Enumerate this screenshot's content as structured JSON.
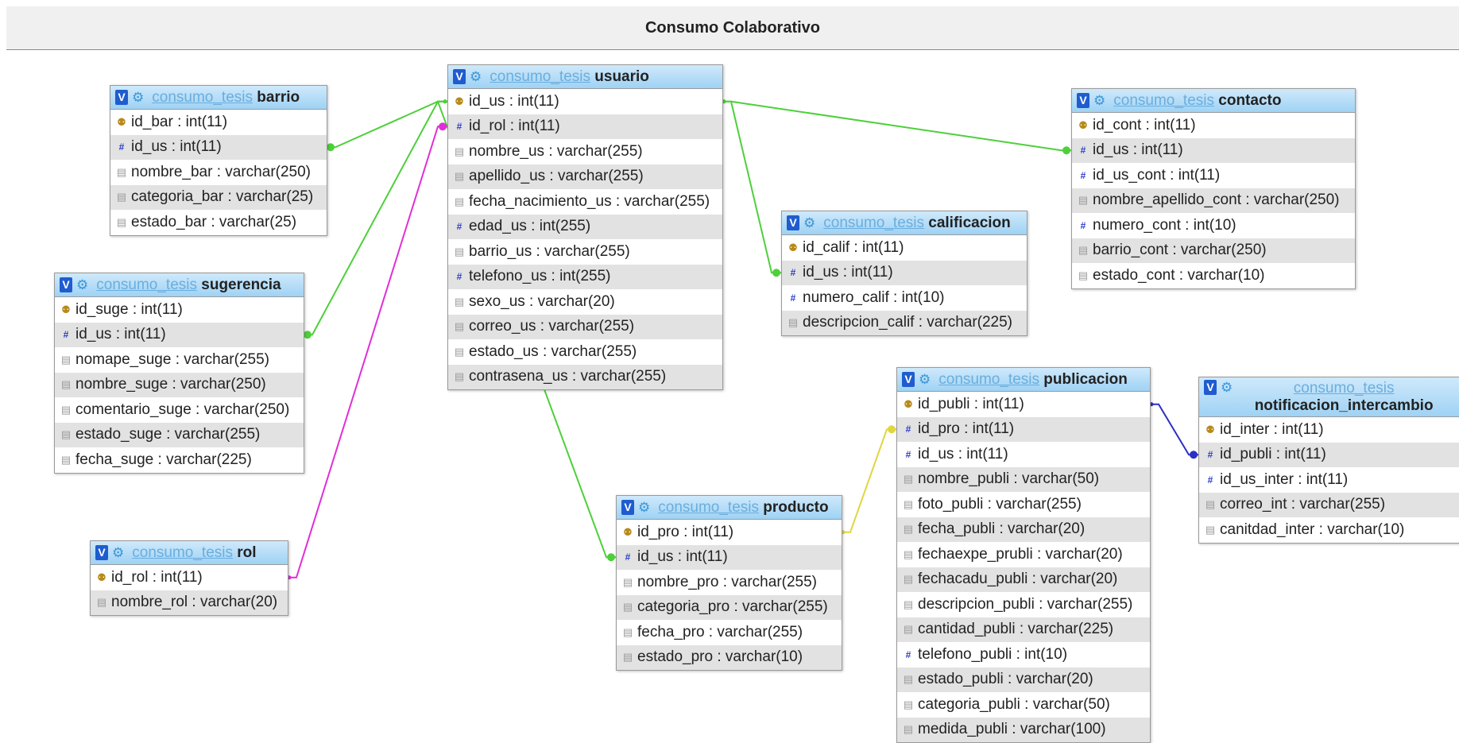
{
  "title": "Consumo Colaborativo",
  "db_name": "consumo_tesis",
  "colors": {
    "green": "#4dd03a",
    "magenta": "#e02ed8",
    "yellow": "#e0d640",
    "blue": "#2c2fc4"
  },
  "tables": [
    {
      "name": "barrio",
      "fields": [
        {
          "text": "id_bar : int(11)",
          "kind": "key"
        },
        {
          "text": "id_us : int(11)",
          "kind": "num"
        },
        {
          "text": "nombre_bar : varchar(250)",
          "kind": "text"
        },
        {
          "text": "categoria_bar : varchar(25)",
          "kind": "text"
        },
        {
          "text": "estado_bar : varchar(25)",
          "kind": "text"
        }
      ]
    },
    {
      "name": "usuario",
      "fields": [
        {
          "text": "id_us : int(11)",
          "kind": "key"
        },
        {
          "text": "id_rol : int(11)",
          "kind": "num"
        },
        {
          "text": "nombre_us : varchar(255)",
          "kind": "text"
        },
        {
          "text": "apellido_us : varchar(255)",
          "kind": "text"
        },
        {
          "text": "fecha_nacimiento_us : varchar(255)",
          "kind": "text"
        },
        {
          "text": "edad_us : int(255)",
          "kind": "num"
        },
        {
          "text": "barrio_us : varchar(255)",
          "kind": "text"
        },
        {
          "text": "telefono_us : int(255)",
          "kind": "num"
        },
        {
          "text": "sexo_us : varchar(20)",
          "kind": "text"
        },
        {
          "text": "correo_us : varchar(255)",
          "kind": "text"
        },
        {
          "text": "estado_us : varchar(255)",
          "kind": "text"
        },
        {
          "text": "contrasena_us : varchar(255)",
          "kind": "text"
        }
      ]
    },
    {
      "name": "contacto",
      "fields": [
        {
          "text": "id_cont : int(11)",
          "kind": "key"
        },
        {
          "text": "id_us : int(11)",
          "kind": "num"
        },
        {
          "text": "id_us_cont : int(11)",
          "kind": "num"
        },
        {
          "text": "nombre_apellido_cont : varchar(250)",
          "kind": "text"
        },
        {
          "text": "numero_cont : int(10)",
          "kind": "num"
        },
        {
          "text": "barrio_cont : varchar(250)",
          "kind": "text"
        },
        {
          "text": "estado_cont : varchar(10)",
          "kind": "text"
        }
      ]
    },
    {
      "name": "calificacion",
      "fields": [
        {
          "text": "id_calif : int(11)",
          "kind": "key"
        },
        {
          "text": "id_us : int(11)",
          "kind": "num"
        },
        {
          "text": "numero_calif : int(10)",
          "kind": "num"
        },
        {
          "text": "descripcion_calif : varchar(225)",
          "kind": "text"
        }
      ]
    },
    {
      "name": "sugerencia",
      "fields": [
        {
          "text": "id_suge : int(11)",
          "kind": "key"
        },
        {
          "text": "id_us : int(11)",
          "kind": "num"
        },
        {
          "text": "nomape_suge : varchar(255)",
          "kind": "text"
        },
        {
          "text": "nombre_suge : varchar(250)",
          "kind": "text"
        },
        {
          "text": "comentario_suge : varchar(250)",
          "kind": "text"
        },
        {
          "text": "estado_suge : varchar(255)",
          "kind": "text"
        },
        {
          "text": "fecha_suge : varchar(225)",
          "kind": "text"
        }
      ]
    },
    {
      "name": "publicacion",
      "fields": [
        {
          "text": "id_publi : int(11)",
          "kind": "key"
        },
        {
          "text": "id_pro : int(11)",
          "kind": "num"
        },
        {
          "text": "id_us : int(11)",
          "kind": "num"
        },
        {
          "text": "nombre_publi : varchar(50)",
          "kind": "text"
        },
        {
          "text": "foto_publi : varchar(255)",
          "kind": "text"
        },
        {
          "text": "fecha_publi : varchar(20)",
          "kind": "text"
        },
        {
          "text": "fechaexpe_prubli : varchar(20)",
          "kind": "text"
        },
        {
          "text": "fechacadu_publi : varchar(20)",
          "kind": "text"
        },
        {
          "text": "descripcion_publi : varchar(255)",
          "kind": "text"
        },
        {
          "text": "cantidad_publi : varchar(225)",
          "kind": "text"
        },
        {
          "text": "telefono_publi : int(10)",
          "kind": "num"
        },
        {
          "text": "estado_publi : varchar(20)",
          "kind": "text"
        },
        {
          "text": "categoria_publi : varchar(50)",
          "kind": "text"
        },
        {
          "text": "medida_publi : varchar(100)",
          "kind": "text"
        }
      ]
    },
    {
      "name": "notificacion_intercambio",
      "fields": [
        {
          "text": "id_inter : int(11)",
          "kind": "key"
        },
        {
          "text": "id_publi : int(11)",
          "kind": "num"
        },
        {
          "text": "id_us_inter : int(11)",
          "kind": "num"
        },
        {
          "text": "correo_int : varchar(255)",
          "kind": "text"
        },
        {
          "text": "canitdad_inter : varchar(10)",
          "kind": "text"
        }
      ]
    },
    {
      "name": "producto",
      "fields": [
        {
          "text": "id_pro : int(11)",
          "kind": "key"
        },
        {
          "text": "id_us : int(11)",
          "kind": "num"
        },
        {
          "text": "nombre_pro : varchar(255)",
          "kind": "text"
        },
        {
          "text": "categoria_pro : varchar(255)",
          "kind": "text"
        },
        {
          "text": "fecha_pro : varchar(255)",
          "kind": "text"
        },
        {
          "text": "estado_pro : varchar(10)",
          "kind": "text"
        }
      ]
    },
    {
      "name": "rol",
      "fields": [
        {
          "text": "id_rol : int(11)",
          "kind": "key"
        },
        {
          "text": "nombre_rol : varchar(20)",
          "kind": "text"
        }
      ]
    }
  ],
  "relations": [
    {
      "from": "usuario.id_us",
      "to": "barrio.id_us",
      "color": "green"
    },
    {
      "from": "usuario.id_us",
      "to": "sugerencia.id_us",
      "color": "green"
    },
    {
      "from": "usuario.id_us",
      "to": "contacto.id_us",
      "color": "green"
    },
    {
      "from": "usuario.id_us",
      "to": "calificacion.id_us",
      "color": "green"
    },
    {
      "from": "usuario.id_us",
      "to": "producto.id_us",
      "color": "green"
    },
    {
      "from": "rol.id_rol",
      "to": "usuario.id_rol",
      "color": "magenta"
    },
    {
      "from": "producto.id_pro",
      "to": "publicacion.id_pro",
      "color": "yellow"
    },
    {
      "from": "publicacion.id_publi",
      "to": "notificacion_intercambio.id_publi",
      "color": "blue"
    }
  ]
}
